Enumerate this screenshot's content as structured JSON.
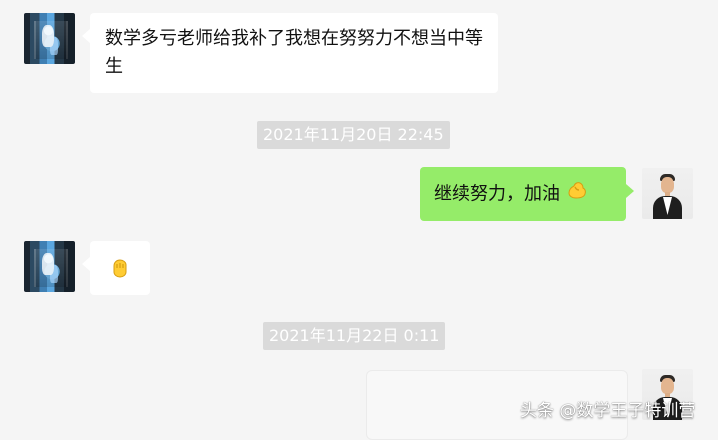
{
  "messages": [
    {
      "side": "left",
      "text": "数学多亏老师给我补了我想在努努力不想当中等生"
    },
    {
      "side": "timestamp",
      "text": "2021年11月20日 22:45"
    },
    {
      "side": "right",
      "text": "继续努力，加油",
      "emoji": "flexed-biceps"
    },
    {
      "side": "left",
      "emoji": "raised-fist"
    },
    {
      "side": "timestamp",
      "text": "2021年11月22日 0:11"
    }
  ],
  "watermark": {
    "text": "头条 @数学王子特训营"
  },
  "colors": {
    "background": "#f5f5f5",
    "left_bubble": "#ffffff",
    "right_bubble": "#95ec69",
    "timestamp_bg": "#dadada",
    "timestamp_text": "#ffffff"
  }
}
